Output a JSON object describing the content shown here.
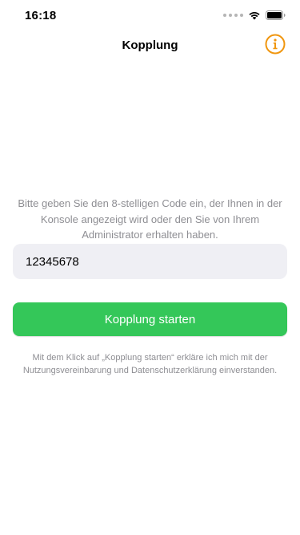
{
  "status_bar": {
    "time": "16:18"
  },
  "nav": {
    "title": "Kopplung",
    "info_icon": "info-circle-icon"
  },
  "instructions": "Bitte geben Sie den 8-stelligen Code ein, der Ihnen in der Konsole angezeigt wird oder den Sie von Ihrem Administrator erhalten haben.",
  "code_field": {
    "value": "12345678"
  },
  "start_button": {
    "label": "Kopplung starten"
  },
  "legal": "Mit dem Klick auf „Kopplung starten“ erkläre ich mich mit der Nutzungsvereinbarung und Datenschutzerklärung einverstanden.",
  "colors": {
    "accent_green": "#34c759",
    "info_orange": "#f0960f",
    "secondary_text": "#8e8e93",
    "input_background": "#efeff4"
  }
}
